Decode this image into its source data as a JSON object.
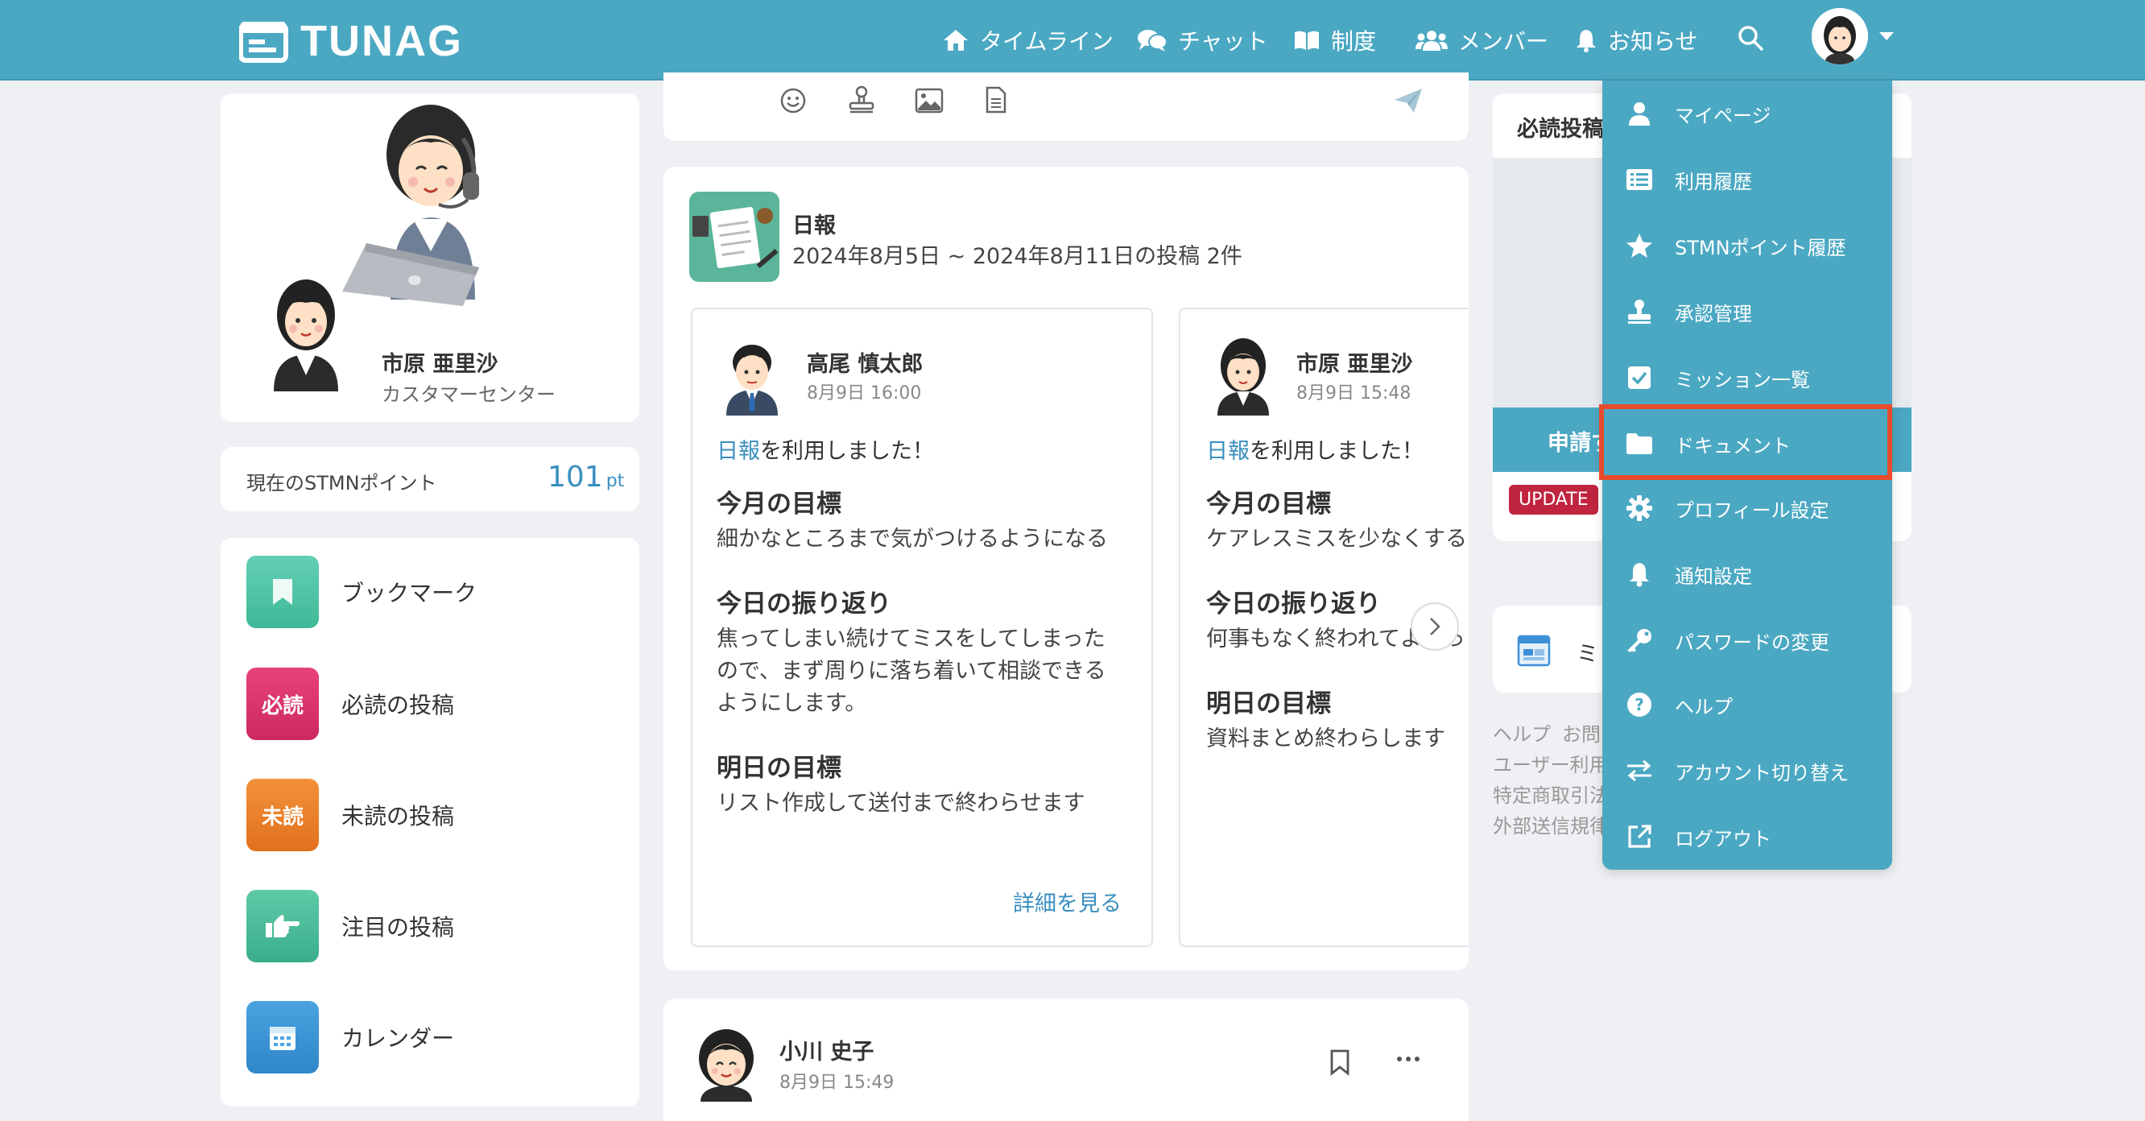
{
  "header": {
    "logo": "TUNAG",
    "nav": {
      "timeline": "タイムライン",
      "chat": "チャット",
      "system": "制度",
      "members": "メンバー",
      "notice": "お知らせ"
    },
    "colors": {
      "brand": "#4ba8c3",
      "highlight": "#e84c2c"
    }
  },
  "profile": {
    "name": "市原 亜里沙",
    "department": "カスタマーセンター"
  },
  "points": {
    "label": "現在のSTMNポイント",
    "value": "101",
    "unit": "pt"
  },
  "side_menu": {
    "bookmark": "ブックマーク",
    "must_badge": "必読",
    "must": "必読の投稿",
    "unread_badge": "未読",
    "unread": "未読の投稿",
    "featured": "注目の投稿",
    "calendar": "カレンダー"
  },
  "daily": {
    "title": "日報",
    "subtitle": "2024年8月5日 ~ 2024年8月11日の投稿 2件",
    "reports": [
      {
        "name": "高尾 慎太郎",
        "time": "8月9日 16:00",
        "lead_link": "日報",
        "lead_text": "を利用しました！",
        "h1": "今月の目標",
        "t1": "細かなところまで気がつけるようになる",
        "h2": "今日の振り返り",
        "t2a": "焦ってしまい続けてミスをしてしまった",
        "t2b": "ので、まず周りに落ち着いて相談できる",
        "t2c": "ようにします。",
        "h3": "明日の目標",
        "t3": "リスト作成して送付まで終わらせます",
        "more": "詳細を見る"
      },
      {
        "name": "市原 亜里沙",
        "time": "8月9日 15:48",
        "lead_link": "日報",
        "lead_text": "を利用しました！",
        "h1": "今月の目標",
        "t1": "ケアレスミスを少なくする",
        "h2": "今日の振り返り",
        "t2a": "何事もなく終われてよかっ",
        "h3": "明日の目標",
        "t3": "資料まとめ終わらします"
      }
    ]
  },
  "post": {
    "name": "小川 史子",
    "time": "8月9日 15:49"
  },
  "right": {
    "must_read": "必読投稿",
    "apply": "申請す",
    "update_badge": "UPDATE",
    "mission": "ミ"
  },
  "footer_links": [
    "ヘルプ",
    "お問",
    "ユーザー利用",
    "特定商取引法",
    "外部送信規律"
  ],
  "dropdown": {
    "mypage": "マイページ",
    "history": "利用履歴",
    "stmn_history": "STMNポイント履歴",
    "approval": "承認管理",
    "missions": "ミッション一覧",
    "documents": "ドキュメント",
    "profile_settings": "プロフィール設定",
    "notification_settings": "通知設定",
    "password": "パスワードの変更",
    "help": "ヘルプ",
    "switch_account": "アカウント切り替え",
    "logout": "ログアウト"
  }
}
